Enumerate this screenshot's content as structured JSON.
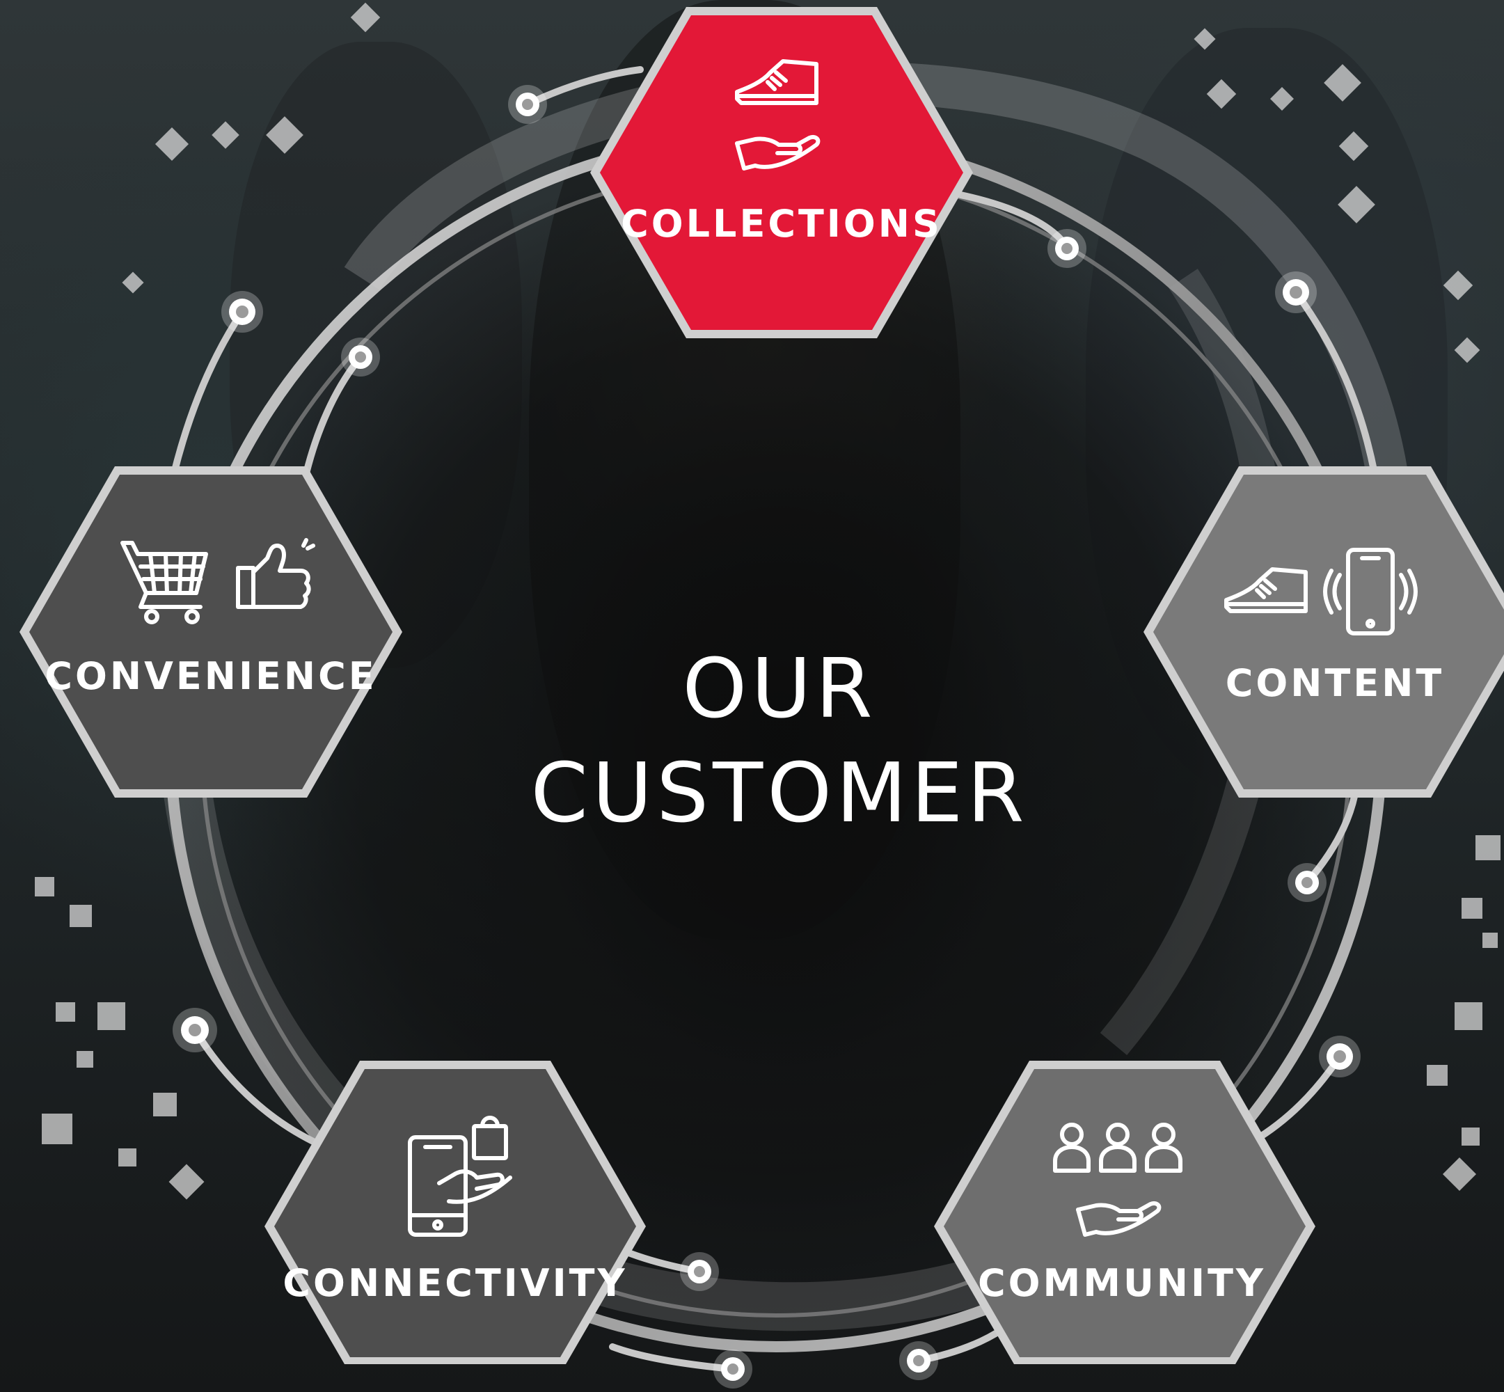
{
  "center_title": {
    "line1": "OUR",
    "line2": "CUSTOMER"
  },
  "hexagons": [
    {
      "label": "COLLECTIONS",
      "icons": [
        "sneaker-icon",
        "open-hand-icon"
      ],
      "color": "#e31837",
      "active": true
    },
    {
      "label": "CONTENT",
      "icons": [
        "sneaker-icon",
        "vibrating-phone-icon"
      ],
      "color": "#7a7a7a",
      "active": false
    },
    {
      "label": "COMMUNITY",
      "icons": [
        "group-people-icon",
        "open-hand-icon"
      ],
      "color": "#6e6e6e",
      "active": false
    },
    {
      "label": "CONNECTIVITY",
      "icons": [
        "phone-shopping-bag-hand-icon"
      ],
      "color": "#4e4e4e",
      "active": false
    },
    {
      "label": "CONVENIENCE",
      "icons": [
        "shopping-cart-icon",
        "thumbs-up-icon"
      ],
      "color": "#4e4e4e",
      "active": false
    }
  ],
  "colors": {
    "accent_red": "#e31837",
    "hex_border": "#cfcfcf",
    "ring": "#b8b8b8"
  }
}
